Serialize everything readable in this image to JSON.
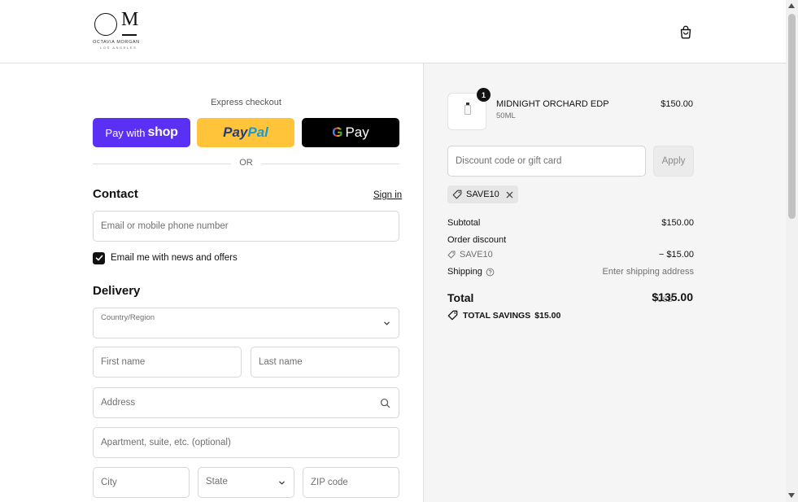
{
  "brand": {
    "logo_name": "OCTAVIA MORGAN",
    "logo_sub": "LOS ANGELES",
    "logo_mark_right": "M"
  },
  "express": {
    "label": "Express checkout",
    "shop_pay_prefix": "Pay with",
    "shop_pay_word": "shop",
    "paypal_part1": "Pay",
    "paypal_part2": "Pal",
    "gpay_g": "G",
    "gpay_word": "Pay",
    "or_text": "OR"
  },
  "contact": {
    "title": "Contact",
    "signin_label": "Sign in",
    "email_placeholder": "Email or mobile phone number",
    "newsletter_label": "Email me with news and offers",
    "newsletter_checked": true
  },
  "delivery": {
    "title": "Delivery",
    "country_label": "Country/Region",
    "country_value": "",
    "first_name_placeholder": "First name",
    "last_name_placeholder": "Last name",
    "address_placeholder": "Address",
    "apartment_placeholder": "Apartment, suite, etc. (optional)",
    "city_placeholder": "City",
    "state_label": "State",
    "zip_placeholder": "ZIP code"
  },
  "order": {
    "item": {
      "name": "MIDNIGHT ORCHARD EDP",
      "variant": "50ML",
      "price": "$150.00",
      "quantity": "1"
    },
    "discount_placeholder": "Discount code or gift card",
    "apply_label": "Apply",
    "applied_code": "SAVE10",
    "subtotal_label": "Subtotal",
    "subtotal_value": "$150.00",
    "order_discount_label": "Order discount",
    "discount_code": "SAVE10",
    "discount_value": "− $15.00",
    "shipping_label": "Shipping",
    "shipping_value": "Enter shipping address",
    "total_label": "Total",
    "total_currency": "USD",
    "total_value": "$135.00",
    "savings_label": "TOTAL SAVINGS",
    "savings_value": "$15.00"
  },
  "colors": {
    "shop_pay": "#5a31f4",
    "paypal": "#ffc439",
    "gpay": "#000000",
    "summary_bg": "#f5f5f5"
  }
}
